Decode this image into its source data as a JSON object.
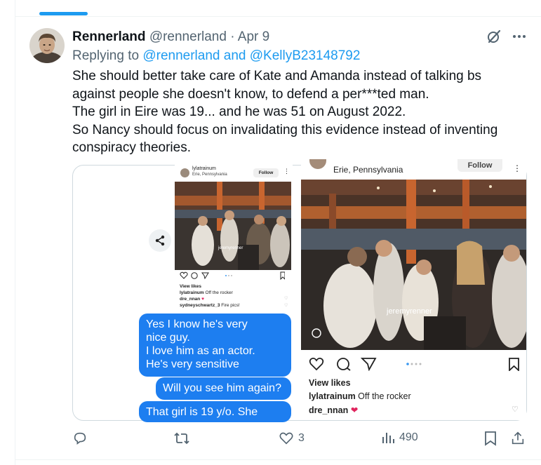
{
  "tweet": {
    "author_name": "Rennerland",
    "author_handle": "@rennerland",
    "separator": "·",
    "date": "Apr 9",
    "replying_prefix": "Replying to",
    "replying_to": "@rennerland and @KellyB23148792",
    "text_lines": [
      "She should better take care of Kate and Amanda instead of talking bs",
      "against people she doesn't know,  to defend a per***ted man.",
      "The girl in Eire was 19... and he was 51 on August 2022.",
      "So Nancy should focus on invalidating this evidence instead of inventing",
      "conspiracy theories."
    ]
  },
  "media": {
    "left_post": {
      "username": "lylatrainum",
      "location": "Erie, Pennsylvania",
      "follow_label": "Follow",
      "tag": "jeremyrenner",
      "view_likes": "View likes",
      "caption_user": "lylatrainum",
      "caption_text": "Off the rocker",
      "comment1_user": "dre_nnan",
      "comment2_user": "sydneyschwartz_3",
      "comment2_text": "Fire pics!"
    },
    "messages": [
      "Yes I know he's very nice guy.",
      "I love him as an actor.",
      "He's very sensitive",
      "Will you see him again?",
      "That girl is 19 y/o. She"
    ],
    "right_post": {
      "location": "Erie, Pennsylvania",
      "follow_label": "Follow",
      "tag": "jeremyrenner",
      "view_likes": "View likes",
      "caption_user": "lylatrainum",
      "caption_text": "Off the rocker",
      "comment_user": "dre_nnan"
    }
  },
  "actions": {
    "reply_count": "",
    "retweet_count": "",
    "like_count": "3",
    "views_count": "490"
  },
  "colors": {
    "accent": "#1d9bf0",
    "text": "#0f1419",
    "secondary": "#536471",
    "bubble": "#1d7ef0",
    "heart": "#e0245e"
  }
}
